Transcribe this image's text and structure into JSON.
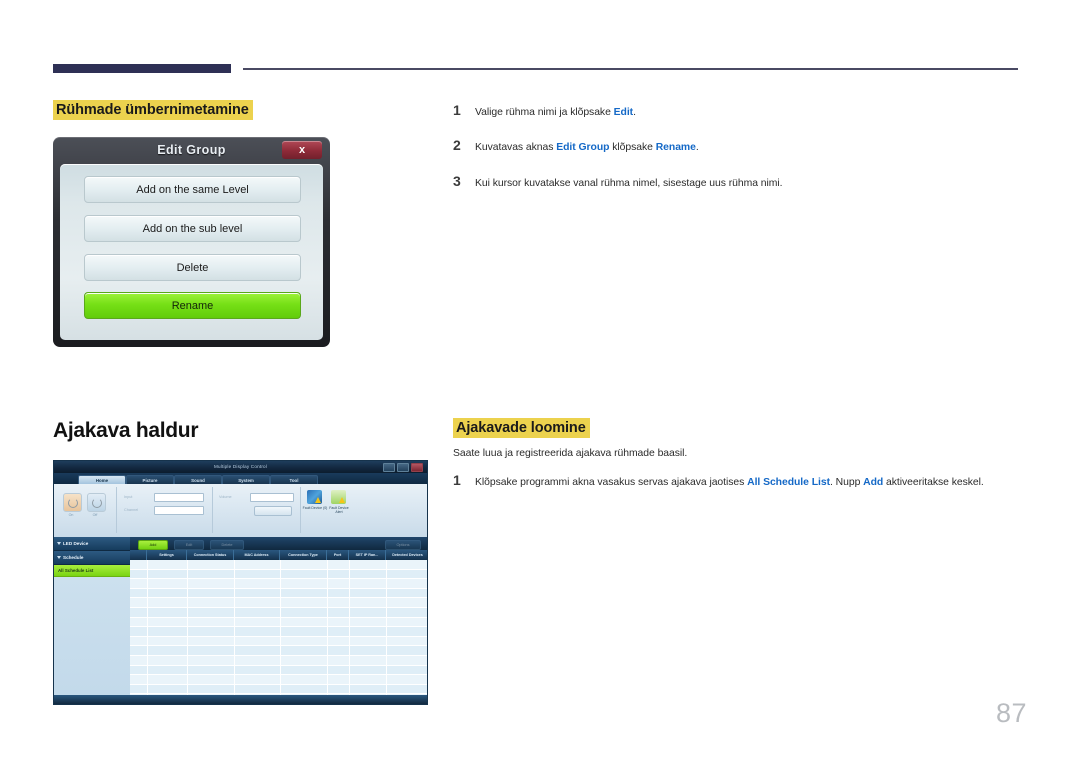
{
  "page": {
    "number": "87"
  },
  "left_column": {
    "section_heading": "Rühmade ümbernimetamine",
    "manager_heading": "Ajakava haldur"
  },
  "edit_group_dialog": {
    "title": "Edit Group",
    "close_label": "x",
    "buttons": [
      {
        "label": "Add on the same Level",
        "style": "default"
      },
      {
        "label": "Add on the sub level",
        "style": "default"
      },
      {
        "label": "Delete",
        "style": "default"
      },
      {
        "label": "Rename",
        "style": "green"
      }
    ]
  },
  "steps_rename": [
    {
      "num": "1",
      "parts": [
        {
          "t": "Valige rühma nimi ja klõpsake ",
          "b": false
        },
        {
          "t": "Edit",
          "b": true
        },
        {
          "t": ".",
          "b": false
        }
      ]
    },
    {
      "num": "2",
      "parts": [
        {
          "t": "Kuvatavas aknas ",
          "b": false
        },
        {
          "t": "Edit Group",
          "b": true
        },
        {
          "t": " klõpsake ",
          "b": false
        },
        {
          "t": "Rename",
          "b": true
        },
        {
          "t": ".",
          "b": false
        }
      ]
    },
    {
      "num": "3",
      "parts": [
        {
          "t": "Kui kursor kuvatakse vanal rühma nimel, sisestage uus rühma nimi.",
          "b": false
        }
      ]
    }
  ],
  "schedule_section": {
    "heading": "Ajakavade loomine",
    "intro": "Saate luua ja registreerida ajakava rühmade baasil.",
    "steps": [
      {
        "num": "1",
        "parts": [
          {
            "t": "Klõpsake programmi akna vasakus servas ajakava jaotises ",
            "b": false
          },
          {
            "t": "All Schedule List",
            "b": true
          },
          {
            "t": ". Nupp ",
            "b": false
          },
          {
            "t": "Add",
            "b": true
          },
          {
            "t": " aktiveeritakse keskel.",
            "b": false
          }
        ]
      }
    ]
  },
  "mdc_app": {
    "window_title": "Multiple Display Control",
    "window_buttons": [
      "minimize",
      "maximize",
      "close"
    ],
    "help_icon": "?",
    "tabs": [
      {
        "label": "Home",
        "active": true
      },
      {
        "label": "Picture",
        "active": false
      },
      {
        "label": "Sound",
        "active": false
      },
      {
        "label": "System",
        "active": false
      },
      {
        "label": "Tool",
        "active": false
      }
    ],
    "ribbon": {
      "power_on_label": "On",
      "power_off_label": "Off",
      "field1_label": "Input",
      "field2_label": "Channel",
      "field3_label": "Volume",
      "apply_label": "Apply",
      "fault_device_label": "Fault Device (0)",
      "fault_device_alert_label": "Fault Device Alert"
    },
    "sidebar": {
      "groups": [
        {
          "label": "LED Device",
          "type": "header"
        },
        {
          "label": "Schedule",
          "type": "header"
        },
        {
          "label": "All Schedule List",
          "type": "item-selected"
        }
      ]
    },
    "toolbar_buttons": [
      {
        "label": "Add",
        "style": "green",
        "enabled": true
      },
      {
        "label": "Edit",
        "style": "default",
        "enabled": false
      },
      {
        "label": "Delete",
        "style": "default",
        "enabled": false
      },
      {
        "label": "Options",
        "style": "default",
        "enabled": false
      }
    ],
    "table": {
      "columns": [
        "Settings",
        "Connection Status",
        "MAC Address",
        "Connection Type",
        "Port",
        "SET IP Ran...",
        "Detected Devices"
      ],
      "rows": []
    }
  },
  "colors": {
    "highlight": "#ecd24e",
    "link_blue": "#1569c7",
    "rule_navy": "#2e3055",
    "accent_green": "#76e016",
    "page_number": "#b9bcc0"
  }
}
